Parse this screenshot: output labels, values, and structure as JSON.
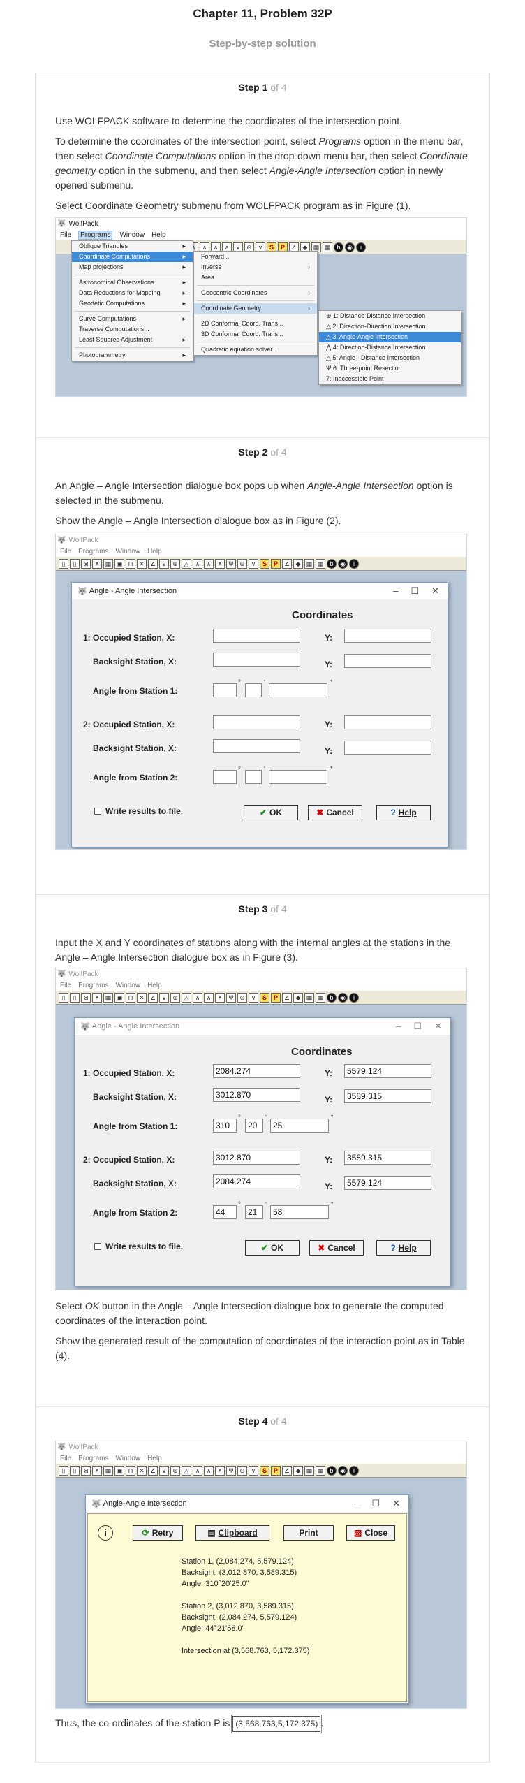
{
  "header": {
    "title": "Chapter 11, Problem 32P",
    "subtitle": "Step-by-step solution"
  },
  "steps": [
    {
      "label": "Step 1",
      "of": " of 4"
    },
    {
      "label": "Step 2",
      "of": " of 4"
    },
    {
      "label": "Step 3",
      "of": " of 4"
    },
    {
      "label": "Step 4",
      "of": " of 4"
    }
  ],
  "step1": {
    "p1": "Use WOLFPACK software to determine the coordinates of the intersection point.",
    "p2_a": "To determine the coordinates of the intersection point, select ",
    "p2_b": "Programs",
    "p2_c": " option in the menu bar, then select ",
    "p2_d": "Coordinate Computations",
    "p2_e": " option in the drop-down menu bar, then select ",
    "p2_f": "Coordinate geometry",
    "p2_g": " option in the submenu, and then select ",
    "p2_h": "Angle-Angle Intersection",
    "p2_i": " option in newly opened submenu.",
    "p3": "Select Coordinate Geometry submenu from WOLFPACK program as in Figure (1)."
  },
  "step2": {
    "p1_a": "An Angle – Angle Intersection dialogue box pops up when ",
    "p1_b": "Angle-Angle Intersection",
    "p1_c": " option is selected in the submenu.",
    "p2": "Show the Angle – Angle Intersection dialogue box as in Figure (2)."
  },
  "step3": {
    "p1": "Input the X and Y coordinates of stations along with the internal angles at the stations in the Angle – Angle Intersection dialogue box as in Figure (3).",
    "p2_a": "Select ",
    "p2_b": "OK",
    "p2_c": " button in the Angle – Angle Intersection dialogue box to generate the computed coordinates of the interaction point.",
    "p3": "Show the generated result of the computation of coordinates of the interaction point as in Table (4)."
  },
  "step4": {
    "conclusion": "Thus, the co-ordinates of the station P is",
    "answer": "(3,568.763,5,172.375)",
    "period": "."
  },
  "app": {
    "name": "WolfPack",
    "menus": [
      "File",
      "Programs",
      "Window",
      "Help"
    ]
  },
  "programs_menu": [
    "Oblique Triangles",
    "Coordinate Computations",
    "Map projections",
    "Astronomical Observations",
    "Data Reductions for Mapping",
    "Geodetic Computations",
    "Curve Computations",
    "Traverse Computations...",
    "Least Squares Adjustment",
    "Photogrammetry"
  ],
  "coord_menu": [
    "Forward...",
    "Inverse",
    "Area",
    "Geocentric Coordinates",
    "Coordinate Geometry",
    "2D Conformal Coord. Trans...",
    "3D Conformal Coord. Trans...",
    "Quadratic equation solver..."
  ],
  "cogo_menu": [
    "1: Distance-Distance Intersection",
    "2: Direction-Direction Intersection",
    "3: Angle-Angle Intersection",
    "4: Direction-Distance Intersection",
    "5: Angle - Distance Intersection",
    "6: Three-point Resection",
    "7: Inaccessible Point"
  ],
  "toolbar": {
    "s_label": "S",
    "p_label": "P"
  },
  "dialog": {
    "title": "Angle - Angle Intersection",
    "coords_heading": "Coordinates",
    "occ1": "1: Occupied Station,  X:",
    "bs1": "Backsight Station,  X:",
    "ang1": "Angle from Station 1:",
    "occ2": "2: Occupied Station,  X:",
    "bs2": "Backsight Station,  X:",
    "ang2": "Angle from Station 2:",
    "y_label": "Y:",
    "write": "Write results to file.",
    "ok": "OK",
    "cancel": "Cancel",
    "help": "Help",
    "deg": "°",
    "min": "'",
    "sec": "\""
  },
  "filled": {
    "occ1_x": "2084.274",
    "occ1_y": "5579.124",
    "bs1_x": "3012.870",
    "bs1_y": "3589.315",
    "ang1_d": "310",
    "ang1_m": "20",
    "ang1_s": "25",
    "occ2_x": "3012.870",
    "occ2_y": "3589.315",
    "bs2_x": "2084.274",
    "bs2_y": "5579.124",
    "ang2_d": "44",
    "ang2_m": "21",
    "ang2_s": "58"
  },
  "result": {
    "title": "Angle-Angle Intersection",
    "retry": "Retry",
    "clipboard": "Clipboard",
    "print": "Print",
    "close": "Close",
    "lines": [
      "Station 1, (2,084.274, 5,579.124)",
      "Backsight, (3,012.870, 3,589.315)",
      "Angle: 310°20'25.0\"",
      "",
      "Station 2, (3,012.870, 3,589.315)",
      "Backsight, (2,084.274, 5,579.124)",
      "Angle: 44°21'58.0\"",
      "",
      "Intersection at (3,568.763, 5,172.375)"
    ]
  }
}
